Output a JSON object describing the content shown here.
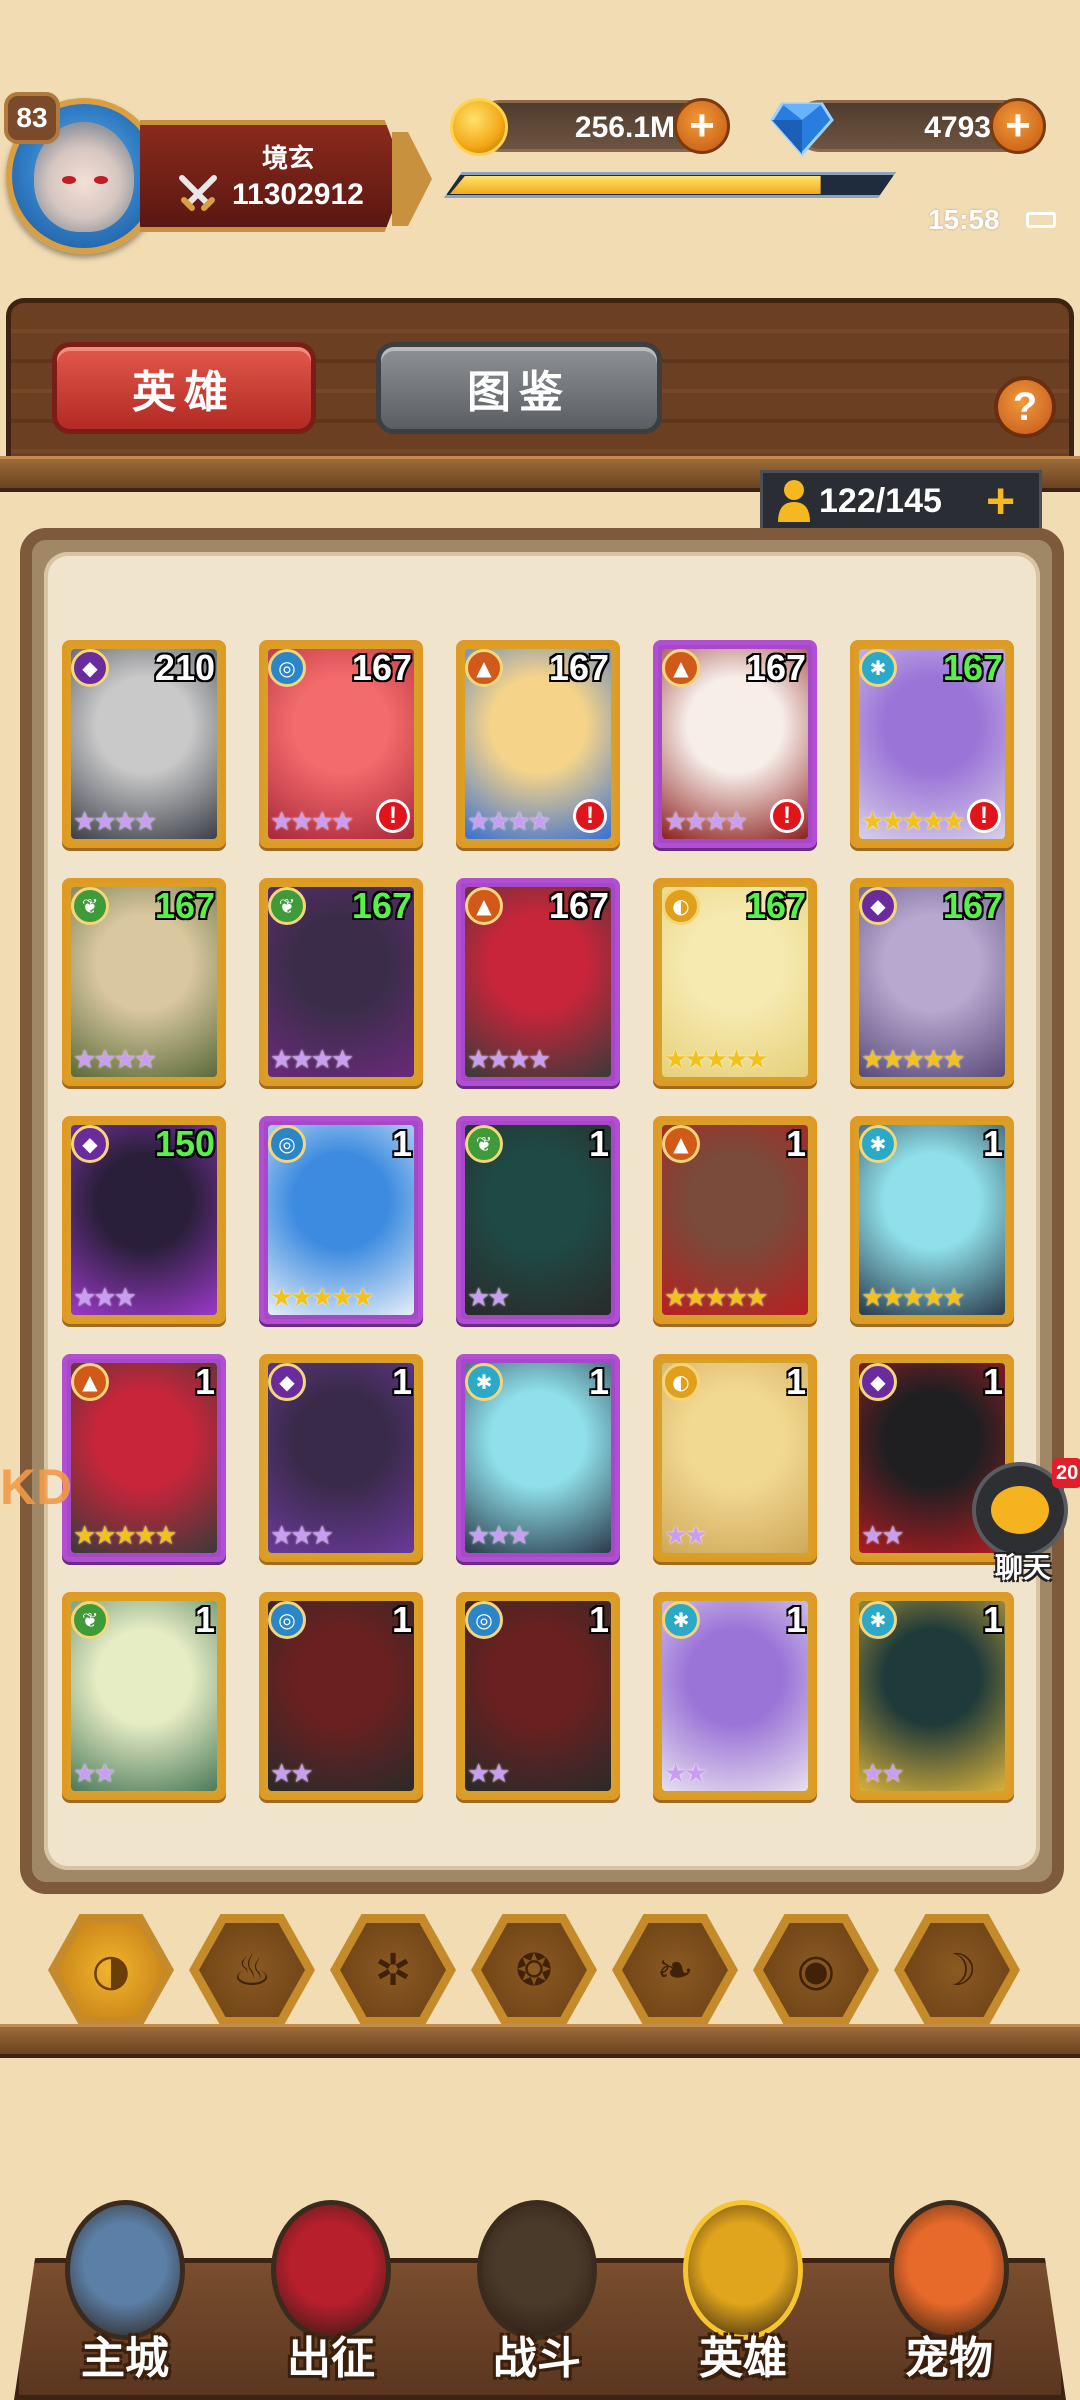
{
  "player": {
    "level": "83",
    "name": "境玄",
    "power": "11302912",
    "exp_fraction": 0.82
  },
  "resources": {
    "gold": "256.1M",
    "gems": "4793"
  },
  "status": {
    "time": "15:58"
  },
  "tabs": {
    "heroes": "英雄",
    "album": "图鉴"
  },
  "help": "?",
  "capacity": "122/145",
  "heroes": [
    {
      "level": "210",
      "element": "dark",
      "stars": "★★★★",
      "frame": "gold",
      "alert": false,
      "green": false,
      "colors": [
        "#c9c9c9",
        "#3b3e48"
      ]
    },
    {
      "level": "167",
      "element": "water",
      "stars": "★★★★",
      "frame": "gold",
      "alert": true,
      "green": false,
      "colors": [
        "#f36b6b",
        "#a8273a"
      ]
    },
    {
      "level": "167",
      "element": "fire",
      "stars": "★★★★",
      "frame": "gold",
      "alert": true,
      "green": false,
      "colors": [
        "#f5d48a",
        "#3a6fd1"
      ]
    },
    {
      "level": "167",
      "element": "fire",
      "stars": "★★★★",
      "frame": "purple",
      "alert": true,
      "green": false,
      "colors": [
        "#f7eee8",
        "#8c2020"
      ]
    },
    {
      "level": "167",
      "element": "ice",
      "stars": "★★★★★",
      "frame": "gold",
      "alert": true,
      "green": true,
      "colors": [
        "#9b74d8",
        "#d8cfe6"
      ]
    },
    {
      "level": "167",
      "element": "wood",
      "stars": "★★★★",
      "frame": "gold",
      "alert": false,
      "green": true,
      "colors": [
        "#d9c79f",
        "#5a6a3a"
      ]
    },
    {
      "level": "167",
      "element": "wood",
      "stars": "★★★★",
      "frame": "gold",
      "alert": false,
      "green": true,
      "colors": [
        "#3b2d4a",
        "#6a2a7a"
      ]
    },
    {
      "level": "167",
      "element": "fire",
      "stars": "★★★★",
      "frame": "purple",
      "alert": false,
      "green": false,
      "colors": [
        "#c9253a",
        "#3a3a3a"
      ]
    },
    {
      "level": "167",
      "element": "light",
      "stars": "★★★★★",
      "frame": "gold",
      "alert": false,
      "green": true,
      "colors": [
        "#f6eab0",
        "#e6d07a"
      ]
    },
    {
      "level": "167",
      "element": "dark",
      "stars": "★★★★★",
      "frame": "gold",
      "alert": false,
      "green": true,
      "colors": [
        "#b7a8cf",
        "#5a4a7a"
      ]
    },
    {
      "level": "150",
      "element": "dark",
      "stars": "★★★",
      "frame": "gold",
      "alert": false,
      "green": true,
      "colors": [
        "#2a1f3a",
        "#9b39c9"
      ]
    },
    {
      "level": "1",
      "element": "water",
      "stars": "★★★★★",
      "frame": "purple",
      "alert": false,
      "green": false,
      "colors": [
        "#3c8be0",
        "#e6eef8"
      ]
    },
    {
      "level": "1",
      "element": "wood",
      "stars": "★★",
      "frame": "purple",
      "alert": false,
      "green": false,
      "colors": [
        "#1f4a44",
        "#2a2a2a"
      ]
    },
    {
      "level": "1",
      "element": "fire",
      "stars": "★★★★★",
      "frame": "gold",
      "alert": false,
      "green": false,
      "colors": [
        "#7a4a3a",
        "#b82020"
      ]
    },
    {
      "level": "1",
      "element": "ice",
      "stars": "★★★★★",
      "frame": "gold",
      "alert": false,
      "green": false,
      "colors": [
        "#8fe0ea",
        "#2a3a4a"
      ]
    },
    {
      "level": "1",
      "element": "fire",
      "stars": "★★★★★",
      "frame": "purple",
      "alert": false,
      "green": false,
      "colors": [
        "#c9253a",
        "#3a3a3a"
      ]
    },
    {
      "level": "1",
      "element": "dark",
      "stars": "★★★",
      "frame": "gold",
      "alert": false,
      "green": false,
      "colors": [
        "#3a2a4a",
        "#6a3a9a"
      ]
    },
    {
      "level": "1",
      "element": "ice",
      "stars": "★★★",
      "frame": "purple",
      "alert": false,
      "green": false,
      "colors": [
        "#8fe0ea",
        "#2a3a4a"
      ]
    },
    {
      "level": "1",
      "element": "light",
      "stars": "★★",
      "frame": "gold",
      "alert": false,
      "green": false,
      "colors": [
        "#f2d992",
        "#cfa95a"
      ]
    },
    {
      "level": "1",
      "element": "dark",
      "stars": "★★",
      "frame": "gold",
      "alert": false,
      "green": false,
      "colors": [
        "#1f1f22",
        "#b01c22"
      ]
    },
    {
      "level": "1",
      "element": "wood",
      "stars": "★★",
      "frame": "gold",
      "alert": false,
      "green": false,
      "colors": [
        "#e6ecc4",
        "#4a7a5a"
      ]
    },
    {
      "level": "1",
      "element": "water",
      "stars": "★★",
      "frame": "gold",
      "alert": false,
      "green": false,
      "colors": [
        "#6a2020",
        "#2a2a2a"
      ]
    },
    {
      "level": "1",
      "element": "water",
      "stars": "★★",
      "frame": "gold",
      "alert": false,
      "green": false,
      "colors": [
        "#6a2020",
        "#2a2a2a"
      ]
    },
    {
      "level": "1",
      "element": "ice",
      "stars": "★★",
      "frame": "gold",
      "alert": false,
      "green": false,
      "colors": [
        "#9b74d8",
        "#e8e0ee"
      ]
    },
    {
      "level": "1",
      "element": "ice",
      "stars": "★★",
      "frame": "gold",
      "alert": false,
      "green": false,
      "colors": [
        "#1f3a3a",
        "#d9b13a"
      ]
    }
  ],
  "element_filters": [
    "all-icon",
    "fire-icon",
    "ice-icon",
    "water-icon",
    "wood-icon",
    "dark-icon",
    "light-icon"
  ],
  "chat": {
    "label": "聊天",
    "badge": "20"
  },
  "side_logo": "KD",
  "nav": [
    {
      "label": "主城",
      "icon": "castle-icon",
      "color": "#5b7fa6"
    },
    {
      "label": "出征",
      "icon": "expedition-icon",
      "color": "#b81f2d"
    },
    {
      "label": "战斗",
      "icon": "battle-icon",
      "color": "#4a3a2a"
    },
    {
      "label": "英雄",
      "icon": "hero-icon",
      "color": "#e0a51c"
    },
    {
      "label": "宠物",
      "icon": "pet-icon",
      "color": "#e86a2a"
    }
  ]
}
